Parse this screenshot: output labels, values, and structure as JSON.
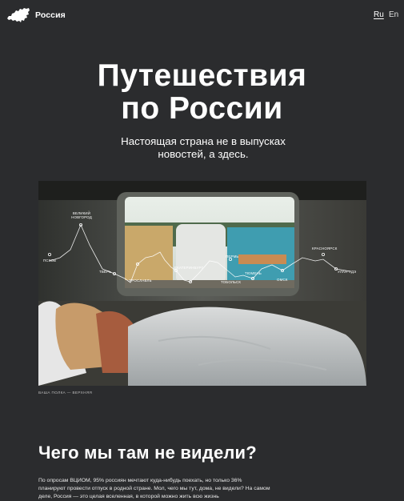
{
  "header": {
    "brand": "Россия",
    "logo_icon": "russia-map-icon",
    "lang_ru": "Ru",
    "lang_en": "En"
  },
  "hero": {
    "title_line1": "Путешествия",
    "title_line2": "по России",
    "subtitle_line1": "Настоящая страна не в выпусках",
    "subtitle_line2": "новостей, а здесь."
  },
  "photo": {
    "caption": "Ваша полка — верхняя",
    "route": {
      "cities": [
        {
          "name": "Псков",
          "top": false
        },
        {
          "name": "Великий Новгород",
          "top": true
        },
        {
          "name": "Тверь",
          "top": false
        },
        {
          "name": "Ярославль",
          "top": false
        },
        {
          "name": "Екатеринбург",
          "top": false
        },
        {
          "name": "Тобольск",
          "top": false
        },
        {
          "name": "Пермь",
          "top": false
        },
        {
          "name": "Тюмень",
          "top": false
        },
        {
          "name": "Омск",
          "top": false
        },
        {
          "name": "Красноярск",
          "top": true
        },
        {
          "name": "Улан-Удэ",
          "top": false
        }
      ]
    }
  },
  "section": {
    "title": "Чего мы там не видели?",
    "body": "По опросам ВЦИОМ, 95% россиян мечтают куда-нибудь поехать, но только 36% планируют провести отпуск в родной стране. Мол, чего мы тут, дома, не видели? На самом деле, Россия — это целая вселенная, в которой можно жить всю жизнь"
  },
  "colors": {
    "background": "#2b2c2e",
    "text": "#ffffff"
  }
}
